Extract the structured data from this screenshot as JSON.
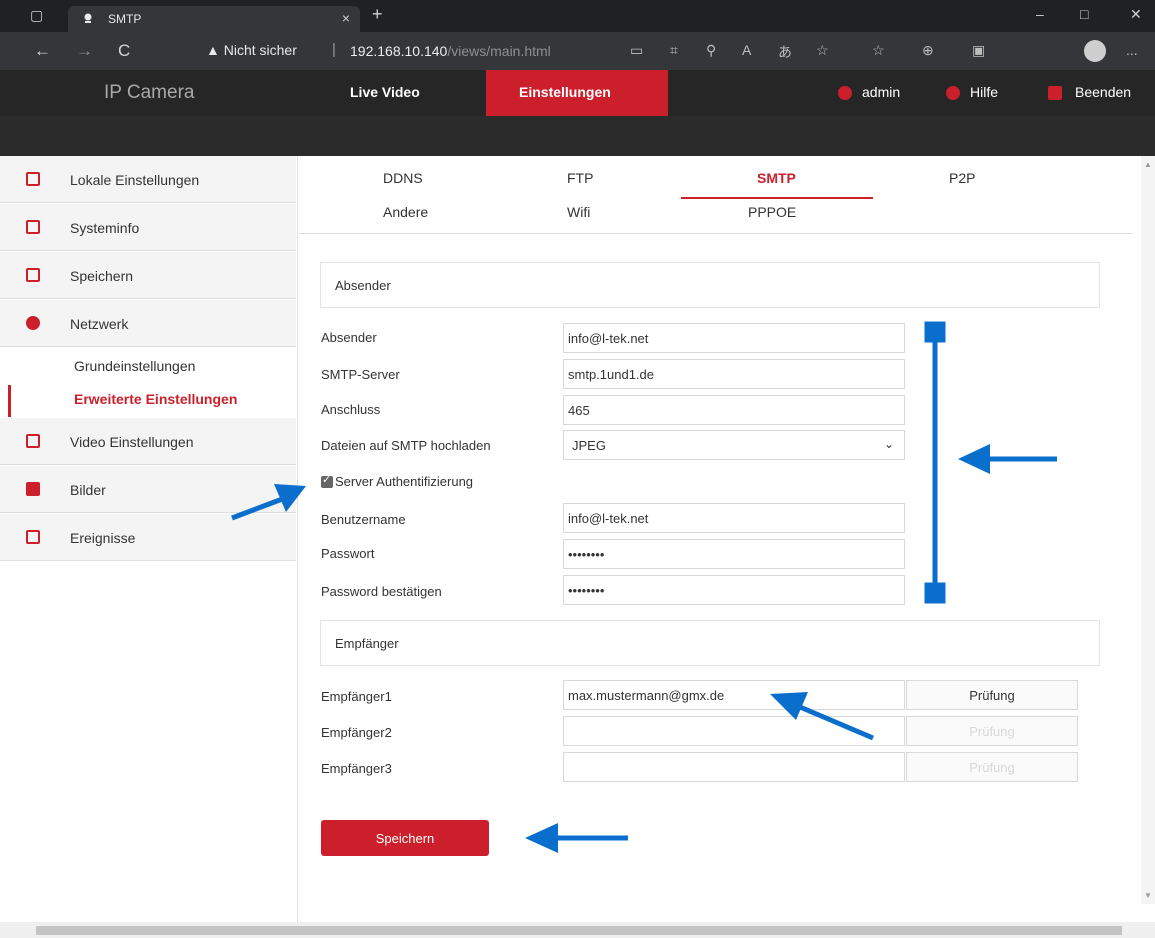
{
  "browser": {
    "tab_title": "SMTP",
    "tab_close": "×",
    "new_tab": "+",
    "security_warning": "Nicht sicher",
    "url_host": "192.168.10.140",
    "url_path": "/views/main.html",
    "back_icon": "←",
    "forward_icon": "→",
    "reload_icon": "C",
    "more_icon": "...",
    "minimize_icon": "–",
    "maximize_icon": "□",
    "close_icon": "✕"
  },
  "header": {
    "brand": "IP Camera",
    "nav": [
      "Live Video",
      "Einstellungen"
    ],
    "user": "admin",
    "help": "Hilfe",
    "logout": "Beenden"
  },
  "sidebar": {
    "items": [
      {
        "label": "Lokale Einstellungen",
        "icon": "monitor-icon"
      },
      {
        "label": "Systeminfo",
        "icon": "info-icon"
      },
      {
        "label": "Speichern",
        "icon": "disk-icon"
      },
      {
        "label": "Netzwerk",
        "icon": "globe-icon"
      },
      {
        "label": "Video Einstellungen",
        "icon": "video-icon"
      },
      {
        "label": "Bilder",
        "icon": "image-icon"
      },
      {
        "label": "Ereignisse",
        "icon": "event-icon"
      }
    ],
    "network_sub": [
      "Grundeinstellungen",
      "Erweiterte Einstellungen"
    ]
  },
  "subtabs": {
    "row1": [
      "DDNS",
      "FTP",
      "SMTP",
      "P2P"
    ],
    "row2": [
      "Andere",
      "Wifi",
      "PPPOE"
    ]
  },
  "sender": {
    "section_title": "Absender",
    "sender_label": "Absender",
    "sender_value": "info@l-tek.net",
    "server_label": "SMTP-Server",
    "server_value": "smtp.1und1.de",
    "port_label": "Anschluss",
    "port_value": "465",
    "upload_label": "Dateien auf SMTP hochladen",
    "upload_value": "JPEG",
    "auth_label": "Server Authentifizierung",
    "user_label": "Benutzername",
    "user_value": "info@l-tek.net",
    "pass_label": "Passwort",
    "pass_value": "••••••••",
    "confirm_label": "Password bestätigen",
    "confirm_value": "••••••••"
  },
  "recipients": {
    "section_title": "Empfänger",
    "rows": [
      {
        "label": "Empfänger1",
        "value": "max.mustermann@gmx.de",
        "test": "Prüfung"
      },
      {
        "label": "Empfänger2",
        "value": "",
        "test": "Prüfung"
      },
      {
        "label": "Empfänger3",
        "value": "",
        "test": "Prüfung"
      }
    ]
  },
  "save_label": "Speichern",
  "colors": {
    "accent": "#cc1f2c",
    "annotation": "#0a6fcc",
    "header_bg": "#262626"
  }
}
